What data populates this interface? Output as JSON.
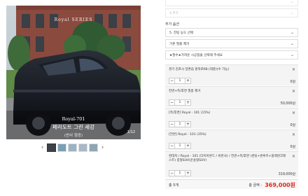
{
  "gallery": {
    "brand_text": "Royal SERIES",
    "caption_line1": "Royal-701",
    "caption_line2": "페리도트 그린 세강",
    "caption_line3": "(썬사 형광)",
    "counter": "1/12",
    "prev_arrow": "‹",
    "next_arrow": "›",
    "thumb_count": 5,
    "selected_thumb": 1
  },
  "options": {
    "select_top_1": "",
    "select_top_2": "4.추가",
    "section_label": "추가 옵션",
    "select_1": "5. 전팅 농도 선택",
    "select_2": "기존 필름 제거",
    "select_3": "★필수★가까운 시공점을 선택해 주세요",
    "chevron": "⌄"
  },
  "items": [
    {
      "name": "경기 김포시 양촌읍 원적로68 (대충)(수 가능)",
      "qty": "1",
      "price": "0원"
    },
    {
      "name": "전면+측/후면 필름 제거",
      "qty": "1",
      "price": "50,000원"
    },
    {
      "name": "[측/후면] Royal - 101 (15%)",
      "qty": "1",
      "price": "0원"
    },
    {
      "name": "[전면] Royal - 101 (35%)",
      "qty": "1",
      "price": "0원"
    },
    {
      "name": "현대차 / Royal - 101 (다이아몬드 / 비반사) / 전면+측/후면 (썬팅+썬루프+블랙썬크레스트) 중형SUV(운송형SUV)",
      "qty": "1",
      "price": "319,000원"
    }
  ],
  "qty_controls": {
    "minus": "−",
    "plus": "+",
    "delete": "×"
  },
  "total": {
    "count_label": "총 5개",
    "total_label": "총 금액 :",
    "amount": "369,000원"
  },
  "colors": {
    "accent": "#d92b1f",
    "panel_bg": "#f4f4f4",
    "border": "#dddddd"
  }
}
